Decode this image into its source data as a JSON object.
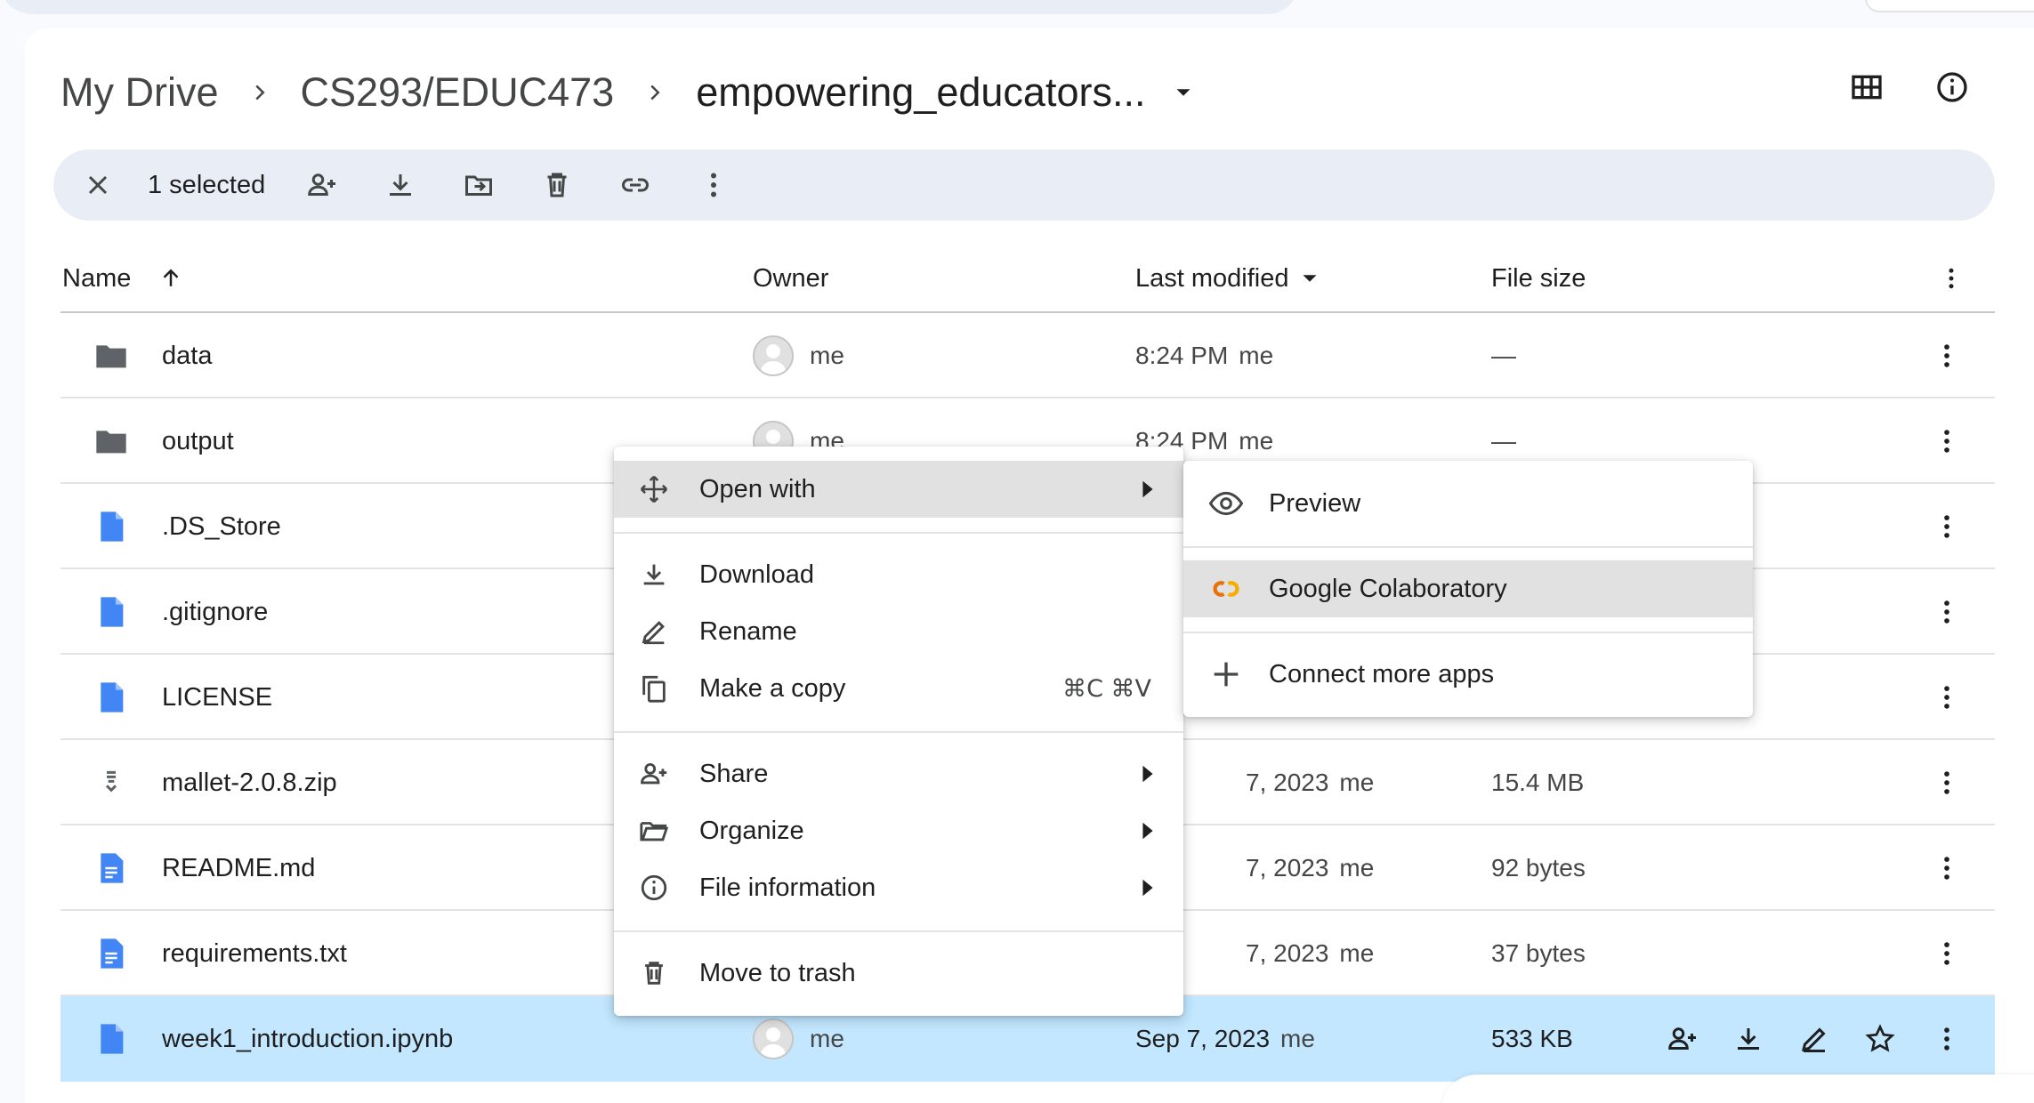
{
  "breadcrumb": {
    "root": "My Drive",
    "parent": "CS293/EDUC473",
    "current": "empowering_educators..."
  },
  "selection": {
    "count_label": "1 selected"
  },
  "table": {
    "headers": {
      "name": "Name",
      "owner": "Owner",
      "modified": "Last modified",
      "size": "File size"
    },
    "rows": [
      {
        "name": "data",
        "type": "folder",
        "owner": "me",
        "modified": "8:24 PM",
        "modified_by": "me",
        "size": "—"
      },
      {
        "name": "output",
        "type": "folder",
        "owner": "me",
        "modified": "8:24 PM",
        "modified_by": "me",
        "size": "—"
      },
      {
        "name": ".DS_Store",
        "type": "file",
        "owner": "",
        "modified": "",
        "modified_by": "",
        "size": ""
      },
      {
        "name": ".gitignore",
        "type": "file",
        "owner": "",
        "modified": "",
        "modified_by": "",
        "size": ""
      },
      {
        "name": "LICENSE",
        "type": "file",
        "owner": "",
        "modified": "",
        "modified_by": "",
        "size": ""
      },
      {
        "name": "mallet-2.0.8.zip",
        "type": "zip",
        "owner": "",
        "modified": "7, 2023",
        "modified_by": "me",
        "size": "15.4 MB"
      },
      {
        "name": "README.md",
        "type": "doc",
        "owner": "",
        "modified": "7, 2023",
        "modified_by": "me",
        "size": "92 bytes"
      },
      {
        "name": "requirements.txt",
        "type": "doc",
        "owner": "",
        "modified": "7, 2023",
        "modified_by": "me",
        "size": "37 bytes"
      },
      {
        "name": "week1_introduction.ipynb",
        "type": "file",
        "owner": "me",
        "modified": "Sep 7, 2023",
        "modified_by": "me",
        "size": "533 KB"
      }
    ]
  },
  "context_menu": {
    "open_with": "Open with",
    "download": "Download",
    "rename": "Rename",
    "make_copy": "Make a copy",
    "make_copy_shortcut": "⌘C ⌘V",
    "share": "Share",
    "organize": "Organize",
    "file_information": "File information",
    "move_to_trash": "Move to trash"
  },
  "submenu": {
    "preview": "Preview",
    "colab": "Google Colaboratory",
    "connect_more": "Connect more apps"
  },
  "colors": {
    "selected_row": "#c2e7ff",
    "toolbar_bg": "#e9eef6",
    "file_blue": "#4285f4",
    "folder_gray": "#5f6368",
    "colab_orange": "#f9ab00"
  }
}
